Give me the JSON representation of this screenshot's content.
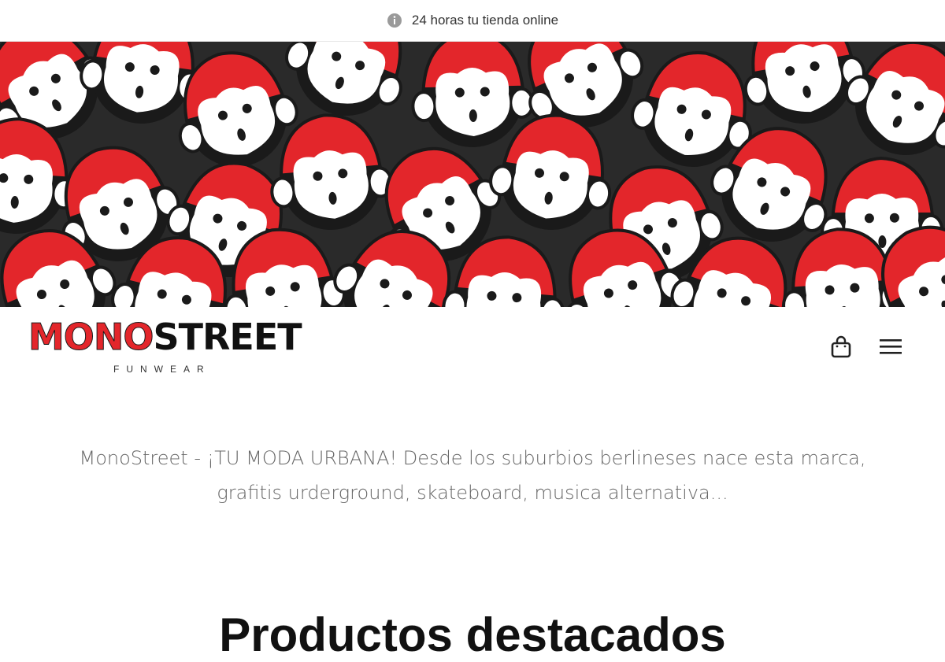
{
  "topbar": {
    "icon": "info-icon",
    "text": "24 horas tu tienda online"
  },
  "banner": {
    "image": "monkey-pattern-banner",
    "colors": {
      "red": "#e3262b",
      "black": "#1a1a1a",
      "white": "#ffffff"
    }
  },
  "header": {
    "logo": {
      "part1": "MONO",
      "part2": "STREET",
      "tagline": "FUNWEAR",
      "accent": "#e3262b"
    },
    "cart_icon": "shopping-bag-icon",
    "menu_icon": "hamburger-menu-icon"
  },
  "intro": {
    "line1": "MonoStreet - ¡TU MODA URBANA! Desde los suburbios berlineses nace esta marca,",
    "line2": "grafitis urderground, skateboard, musica alternativa..."
  },
  "section": {
    "title": "Productos destacados"
  }
}
